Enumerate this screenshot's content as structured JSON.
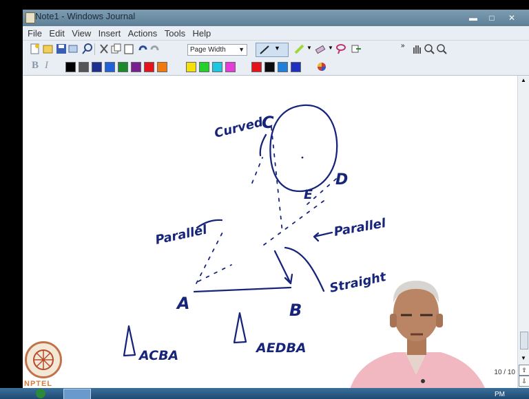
{
  "window": {
    "title": "Note1 - Windows Journal"
  },
  "menu": [
    "File",
    "Edit",
    "View",
    "Insert",
    "Actions",
    "Tools",
    "Help"
  ],
  "toolbar": {
    "zoom_value": "Page Width"
  },
  "palette": [
    "#000000",
    "#555555",
    "#1f2f8f",
    "#1f62d9",
    "#1a8a2a",
    "#7a1f8f",
    "#e3151b",
    "#f07a12",
    "#f4e10b",
    "#22d22a",
    "#1fc6e0",
    "#e53bd9",
    "#e3151b",
    "#0b0b0b",
    "#1f7fd9",
    "#1f2fbf"
  ],
  "handwriting": {
    "curved": "Curved",
    "parallel_left": "Parallel",
    "parallel_right": "Parallel",
    "straight": "Straight",
    "label_c": "C",
    "label_d": "D",
    "label_e": "E",
    "label_a": "A",
    "label_b": "B",
    "triangle_1": "ACBA",
    "triangle_2": "AEDBA",
    "triangle_symbol": "Δ"
  },
  "page_indicator": "10 / 10",
  "logo_text": "NPTEL",
  "clock": "PM"
}
